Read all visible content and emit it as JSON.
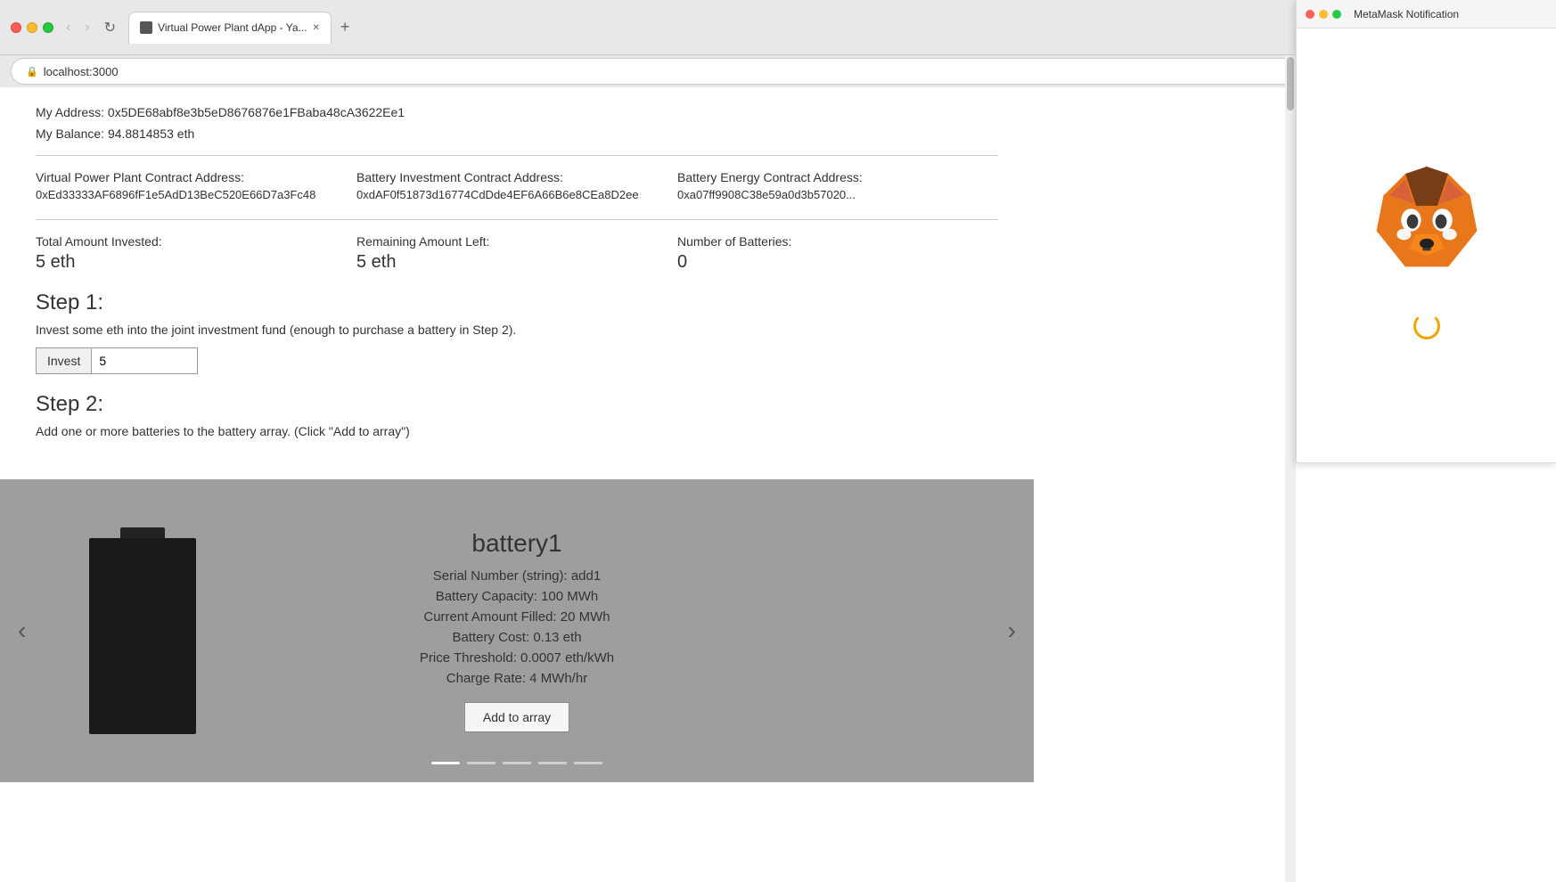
{
  "browser": {
    "tab_title": "Virtual Power Plant dApp - Ya...",
    "url": "localhost:3000",
    "new_tab_label": "+"
  },
  "page": {
    "my_address_label": "My Address:",
    "my_address_value": "0x5DE68abf8e3b5eD8676876e1FBaba48cA3622Ee1",
    "my_balance_label": "My Balance:",
    "my_balance_value": "94.8814853 eth",
    "vpp_contract_label": "Virtual Power Plant Contract Address:",
    "vpp_contract_value": "0xEd33333AF6896fF1e5AdD13BeC520E66D7a3Fc48",
    "battery_invest_label": "Battery Investment Contract Address:",
    "battery_invest_value": "0xdAF0f51873d16774CdDde4EF6A66B6e8CEa8D2ee",
    "battery_energy_label": "Battery Energy Contract Address:",
    "battery_energy_value": "0xa07ff9908C38e59a0d3b57020...",
    "total_invested_label": "Total Amount Invested:",
    "total_invested_value": "5 eth",
    "remaining_label": "Remaining Amount Left:",
    "remaining_value": "5 eth",
    "num_batteries_label": "Number of Batteries:",
    "num_batteries_value": "0",
    "step1_title": "Step 1:",
    "step1_desc": "Invest some eth into the joint investment fund (enough to purchase a battery in Step 2).",
    "invest_button_label": "Invest",
    "invest_input_value": "5",
    "step2_title": "Step 2:",
    "step2_desc": "Add one or more batteries to the battery array. (Click \"Add to array\")",
    "battery_name": "battery1",
    "serial_number_label": "Serial Number (string):",
    "serial_number_value": "add1",
    "capacity_label": "Battery Capacity:",
    "capacity_value": "100 MWh",
    "current_filled_label": "Current Amount Filled:",
    "current_filled_value": "20 MWh",
    "cost_label": "Battery Cost:",
    "cost_value": "0.13 eth",
    "price_threshold_label": "Price Threshold:",
    "price_threshold_value": "0.0007 eth/kWh",
    "charge_rate_label": "Charge Rate:",
    "charge_rate_value": "4 MWh/hr",
    "add_to_array_label": "Add to array"
  },
  "metamask": {
    "title": "MetaMask Notification",
    "panel_label": "MetaMask Notification"
  },
  "carousel": {
    "dots": [
      {
        "active": true
      },
      {
        "active": false
      },
      {
        "active": false
      },
      {
        "active": false
      },
      {
        "active": false
      }
    ]
  }
}
